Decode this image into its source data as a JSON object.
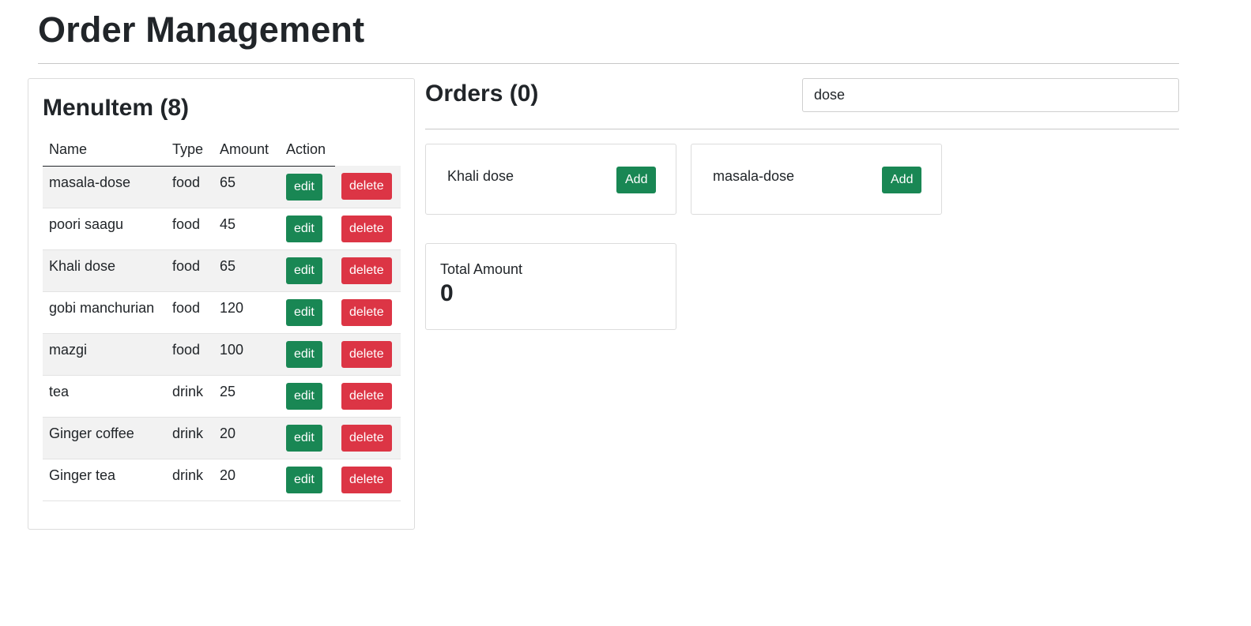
{
  "header": {
    "title": "Order Management"
  },
  "menu": {
    "title": "MenuItem (8)",
    "columns": [
      "Name",
      "Type",
      "Amount",
      "Action"
    ],
    "edit_label": "edit",
    "delete_label": "delete",
    "rows": [
      {
        "name": "masala-dose",
        "type": "food",
        "amount": "65"
      },
      {
        "name": "poori saagu",
        "type": "food",
        "amount": "45"
      },
      {
        "name": "Khali dose",
        "type": "food",
        "amount": "65"
      },
      {
        "name": "gobi manchurian",
        "type": "food",
        "amount": "120"
      },
      {
        "name": "mazgi",
        "type": "food",
        "amount": "100"
      },
      {
        "name": "tea",
        "type": "drink",
        "amount": "25"
      },
      {
        "name": "Ginger coffee",
        "type": "drink",
        "amount": "20"
      },
      {
        "name": "Ginger tea",
        "type": "drink",
        "amount": "20"
      }
    ]
  },
  "orders": {
    "title": "Orders (0)",
    "search_value": "dose",
    "add_label": "Add",
    "results": [
      {
        "name": "Khali dose"
      },
      {
        "name": "masala-dose"
      }
    ],
    "total_label": "Total Amount",
    "total_value": "0"
  },
  "colors": {
    "edit": "#198754",
    "delete": "#dc3545",
    "add": "#198754"
  }
}
